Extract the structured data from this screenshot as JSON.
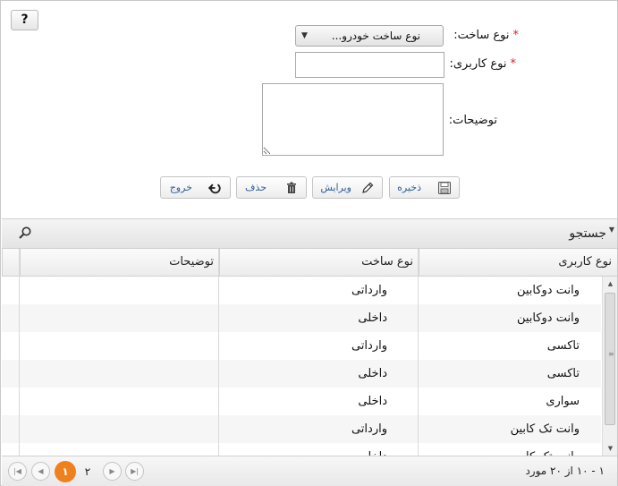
{
  "help": {
    "label": "?"
  },
  "form": {
    "build_type_label": "نوع ساخت:",
    "build_type_value": "نوع ساخت خودرو...",
    "usage_type_label": "نوع کاربری:",
    "usage_type_value": "",
    "description_label": "توضیحات:",
    "required_mark": "*"
  },
  "actions": {
    "save": "ذخیره",
    "edit": "ویرایش",
    "delete": "حذف",
    "exit": "خروج"
  },
  "search": {
    "label": "جستجو"
  },
  "table": {
    "columns": [
      "نوع کاربری",
      "نوع ساخت",
      "توضیحات"
    ],
    "rows": [
      {
        "usage": "وانت دوکابین",
        "build": "وارداتی",
        "desc": ""
      },
      {
        "usage": "وانت دوکابین",
        "build": "داخلی",
        "desc": ""
      },
      {
        "usage": "تاکسی",
        "build": "وارداتی",
        "desc": ""
      },
      {
        "usage": "تاکسی",
        "build": "داخلی",
        "desc": ""
      },
      {
        "usage": "سواری",
        "build": "داخلی",
        "desc": ""
      },
      {
        "usage": "وانت تک کابین",
        "build": "وارداتی",
        "desc": ""
      },
      {
        "usage": "وانت تک کابین",
        "build": "داخلی",
        "desc": ""
      }
    ]
  },
  "pager": {
    "info": "۱ - ۱۰ از ۲۰ مورد",
    "pages": [
      "۱",
      "۲"
    ],
    "active_page": "۱"
  }
}
